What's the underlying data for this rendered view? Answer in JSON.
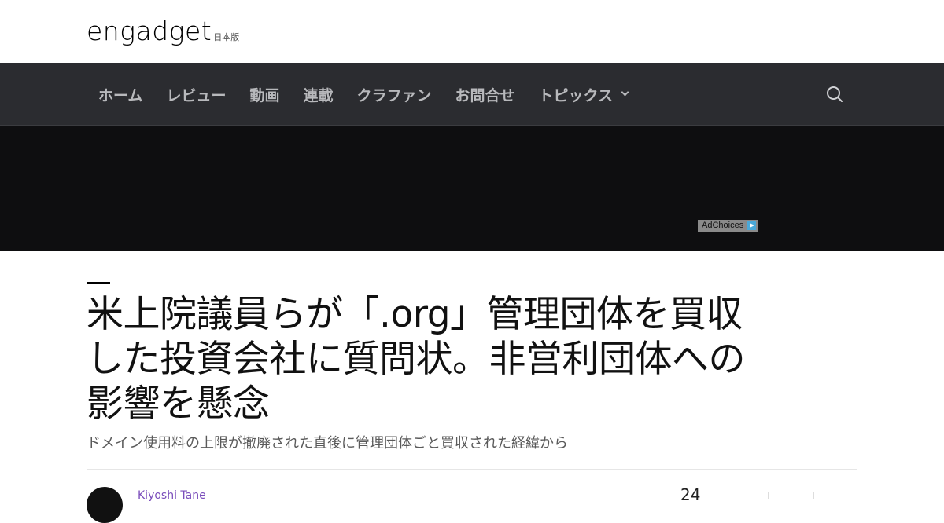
{
  "header": {
    "logo_text": "engadget",
    "logo_sub": "日本版"
  },
  "nav": {
    "items": [
      {
        "label": "ホーム"
      },
      {
        "label": "レビュー"
      },
      {
        "label": "動画"
      },
      {
        "label": "連載"
      },
      {
        "label": "クラファン"
      },
      {
        "label": "お問合せ"
      },
      {
        "label": "トピックス"
      }
    ],
    "search_icon": "search-icon"
  },
  "ad": {
    "adchoices_label": "AdChoices"
  },
  "article": {
    "title": "米上院議員らが「.org」管理団体を買収した投資会社に質問状。非営利団体への影響を懸念",
    "subtitle": "ドメイン使用料の上限が撤廃された直後に管理団体ごと買収された経緯から",
    "author": "Kiyoshi Tane",
    "comment_count": "24"
  },
  "colors": {
    "navbar_bg": "#2b2c30",
    "nav_text": "#b8b9bc",
    "ad_bg": "#0e0e10",
    "author_link": "#7a4dbb"
  }
}
